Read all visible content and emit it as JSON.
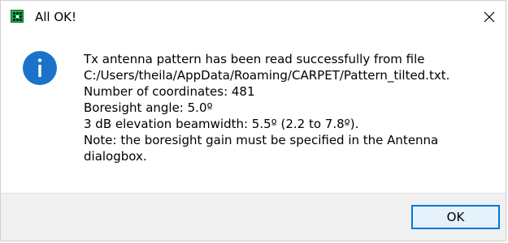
{
  "window": {
    "title": "All OK!",
    "app_icon": "grid-app-icon",
    "close_icon": "close-icon"
  },
  "message": {
    "icon": "info-icon",
    "lines": [
      "Tx antenna pattern has been read successfully from file",
      "C:/Users/theila/AppData/Roaming/CARPET/Pattern_tilted.txt.",
      "Number of coordinates: 481",
      "Boresight angle: 5.0º",
      "3 dB elevation beamwidth: 5.5º (2.2 to 7.8º).",
      "Note: the boresight gain must be specified in the Antenna",
      "dialogbox."
    ]
  },
  "footer": {
    "ok_label": "OK"
  },
  "colors": {
    "info_icon": "#1a73c9",
    "button_border": "#0078d7",
    "button_fill": "#e5f1fb",
    "footer_bg": "#f0f0f0",
    "app_icon": "#1db34a"
  }
}
